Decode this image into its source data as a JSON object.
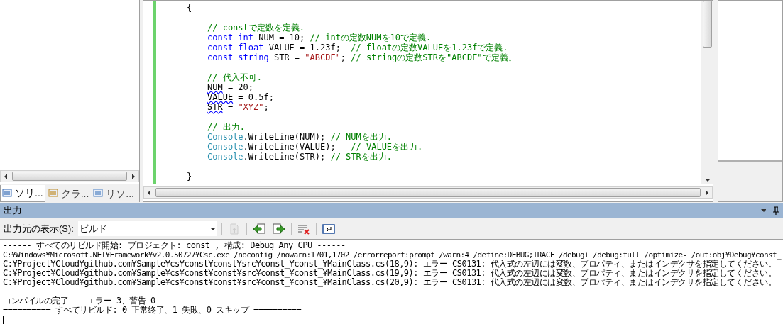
{
  "left_panel": {
    "tabs": [
      {
        "label": "ソリ...",
        "selected": true
      },
      {
        "label": "クラ...",
        "selected": false
      },
      {
        "label": "リソ...",
        "selected": false
      }
    ]
  },
  "editor": {
    "lines": [
      {
        "kind": "brace",
        "tokens": [
          {
            "t": "{",
            "kind": "plain"
          }
        ]
      },
      {
        "kind": "blank"
      },
      {
        "kind": "body",
        "tokens": [
          {
            "t": "// constで定数を定義.",
            "kind": "comment"
          }
        ]
      },
      {
        "kind": "body",
        "tokens": [
          {
            "t": "const int",
            "kind": "kw"
          },
          {
            "t": " NUM = 10; ",
            "kind": "plain"
          },
          {
            "t": "// intの定数NUMを10で定義.",
            "kind": "comment"
          }
        ]
      },
      {
        "kind": "body",
        "tokens": [
          {
            "t": "const float",
            "kind": "kw"
          },
          {
            "t": " VALUE = 1.23f;  ",
            "kind": "plain"
          },
          {
            "t": "// floatの定数VALUEを1.23fで定義.",
            "kind": "comment"
          }
        ]
      },
      {
        "kind": "body",
        "tokens": [
          {
            "t": "const string",
            "kind": "kw"
          },
          {
            "t": " STR = ",
            "kind": "plain"
          },
          {
            "t": "\"ABCDE\"",
            "kind": "string"
          },
          {
            "t": "; ",
            "kind": "plain"
          },
          {
            "t": "// stringの定数STRを\"ABCDE\"で定義。",
            "kind": "comment"
          }
        ]
      },
      {
        "kind": "blank"
      },
      {
        "kind": "body",
        "tokens": [
          {
            "t": "// 代入不可.",
            "kind": "comment"
          }
        ]
      },
      {
        "kind": "body",
        "tokens": [
          {
            "t": "NUM",
            "kind": "error"
          },
          {
            "t": " = 20;",
            "kind": "plain"
          }
        ]
      },
      {
        "kind": "body",
        "tokens": [
          {
            "t": "VALUE",
            "kind": "error"
          },
          {
            "t": " = 0.5f;",
            "kind": "plain"
          }
        ]
      },
      {
        "kind": "body",
        "tokens": [
          {
            "t": "STR",
            "kind": "error"
          },
          {
            "t": " = ",
            "kind": "plain"
          },
          {
            "t": "\"XYZ\"",
            "kind": "string"
          },
          {
            "t": ";",
            "kind": "plain"
          }
        ]
      },
      {
        "kind": "blank"
      },
      {
        "kind": "body",
        "tokens": [
          {
            "t": "// 出力.",
            "kind": "comment"
          }
        ]
      },
      {
        "kind": "body",
        "tokens": [
          {
            "t": "Console",
            "kind": "type"
          },
          {
            "t": ".WriteLine(NUM); ",
            "kind": "plain"
          },
          {
            "t": "// NUMを出力.",
            "kind": "comment"
          }
        ]
      },
      {
        "kind": "body",
        "tokens": [
          {
            "t": "Console",
            "kind": "type"
          },
          {
            "t": ".WriteLine(VALUE);   ",
            "kind": "plain"
          },
          {
            "t": "// VALUEを出力.",
            "kind": "comment"
          }
        ]
      },
      {
        "kind": "body",
        "tokens": [
          {
            "t": "Console",
            "kind": "type"
          },
          {
            "t": ".WriteLine(STR); ",
            "kind": "plain"
          },
          {
            "t": "// STRを出力.",
            "kind": "comment"
          }
        ]
      },
      {
        "kind": "blank"
      },
      {
        "kind": "brace",
        "tokens": [
          {
            "t": "}",
            "kind": "plain"
          }
        ]
      }
    ]
  },
  "output": {
    "title": "出力",
    "source_label": "出力元の表示(S):",
    "source_value": "ビルド",
    "lines": [
      {
        "kind": "text",
        "text": "------ すべてのリビルド開始: プロジェクト: const_, 構成: Debug Any CPU ------"
      },
      {
        "kind": "text",
        "text": "C:¥Windows¥Microsoft.NET¥Framework¥v2.0.50727¥Csc.exe /noconfig /nowarn:1701,1702 /errorreport:prompt /warn:4 /define:DEBUG;TRACE /debug+ /debug:full /optimize- /out:obj¥Debug¥const_"
      },
      {
        "kind": "text",
        "text": "C:¥Project¥Cloud¥github.com¥Sample¥cs¥const¥const¥src¥const_¥const_¥MainClass.cs(18,9): エラー CS0131: 代入式の左辺には変数、プロパティ、またはインデクサを指定してください。"
      },
      {
        "kind": "text",
        "text": "C:¥Project¥Cloud¥github.com¥Sample¥cs¥const¥const¥src¥const_¥const_¥MainClass.cs(19,9): エラー CS0131: 代入式の左辺には変数、プロパティ、またはインデクサを指定してください。"
      },
      {
        "kind": "text",
        "text": "C:¥Project¥Cloud¥github.com¥Sample¥cs¥const¥const¥src¥const_¥const_¥MainClass.cs(20,9): エラー CS0131: 代入式の左辺には変数、プロパティ、またはインデクサを指定してください。"
      },
      {
        "kind": "blank"
      },
      {
        "kind": "text",
        "text": "コンパイルの完了 -- エラー 3、警告 0"
      },
      {
        "kind": "text",
        "text": "========== すべてリビルド: 0 正常終了、1 失敗、0 スキップ =========="
      }
    ]
  }
}
